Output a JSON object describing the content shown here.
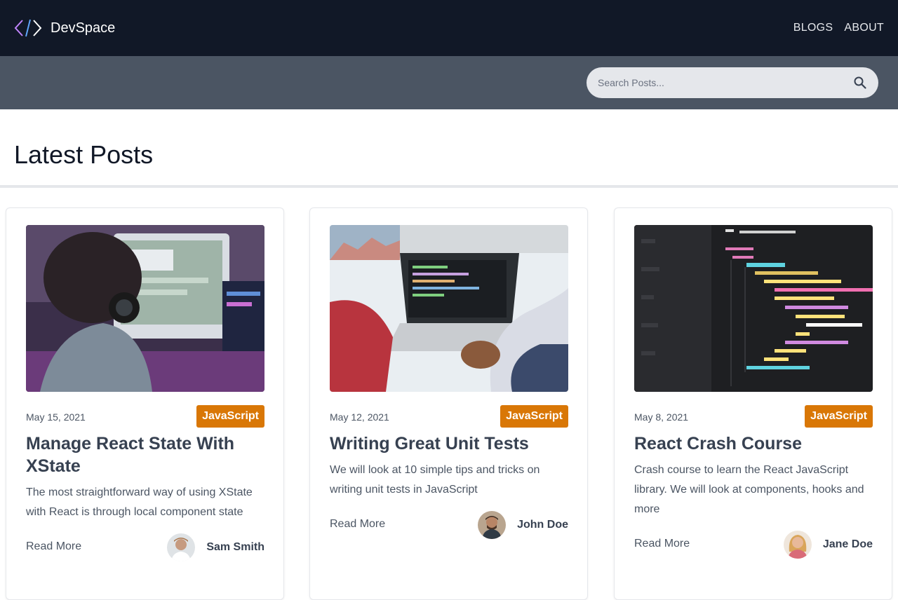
{
  "nav": {
    "brand": "DevSpace",
    "links": [
      "BLOGS",
      "ABOUT"
    ]
  },
  "search": {
    "placeholder": "Search Posts..."
  },
  "main": {
    "heading": "Latest Posts"
  },
  "posts": [
    {
      "date": "May 15, 2021",
      "category": "JavaScript",
      "title": "Manage React State With XState",
      "excerpt": "The most straightforward way of using XState with React is through local component state",
      "read_more": "Read More",
      "author": "Sam Smith"
    },
    {
      "date": "May 12, 2021",
      "category": "JavaScript",
      "title": "Writing Great Unit Tests",
      "excerpt": "We will look at 10 simple tips and tricks on writing unit tests in JavaScript",
      "read_more": "Read More",
      "author": "John Doe"
    },
    {
      "date": "May 8, 2021",
      "category": "JavaScript",
      "title": "React Crash Course",
      "excerpt": "Crash course to learn the React JavaScript library. We will look at components, hooks and more",
      "read_more": "Read More",
      "author": "Jane Doe"
    }
  ],
  "icons": {
    "logo": "code-brackets-icon",
    "search": "search-icon"
  },
  "colors": {
    "navbar": "#111827",
    "search_band": "#4b5563",
    "badge": "#d97706"
  }
}
